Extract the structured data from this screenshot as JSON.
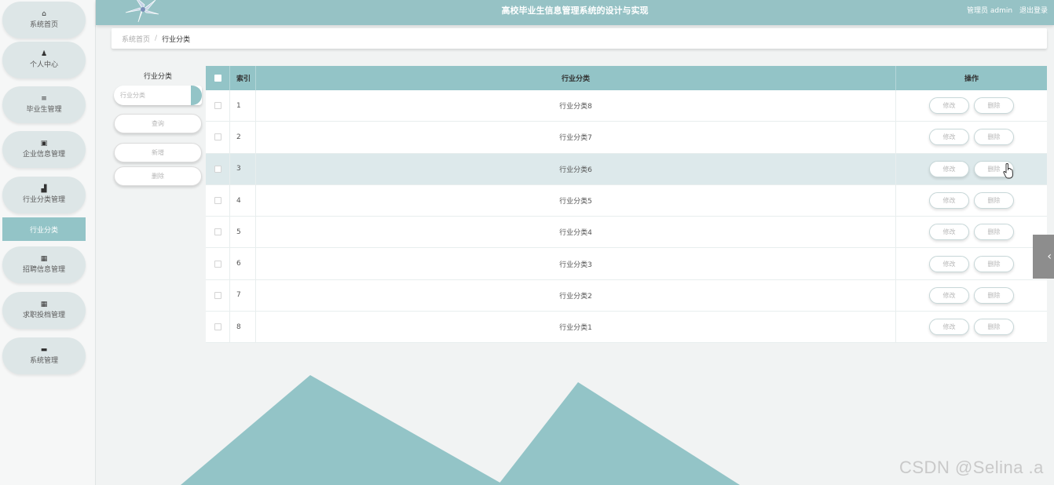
{
  "sidebar": {
    "items": [
      {
        "label": "系统首页",
        "icon": "home-icon",
        "glyph": "⌂"
      },
      {
        "label": "个人中心",
        "icon": "user-icon",
        "glyph": "♟"
      },
      {
        "label": "毕业生管理",
        "icon": "list-icon",
        "glyph": "≡"
      },
      {
        "label": "企业信息管理",
        "icon": "chart-icon",
        "glyph": "▣"
      },
      {
        "label": "行业分类管理",
        "icon": "thumb-icon",
        "glyph": "▟"
      },
      {
        "label": "招聘信息管理",
        "icon": "grid-icon",
        "glyph": "▦"
      },
      {
        "label": "求职投档管理",
        "icon": "grid-icon",
        "glyph": "▦"
      },
      {
        "label": "系统管理",
        "icon": "monitor-icon",
        "glyph": "▬"
      }
    ],
    "active_sub": "行业分类"
  },
  "header": {
    "title": "高校毕业生信息管理系统的设计与实现",
    "user": "管理员 admin",
    "logout": "退出登录"
  },
  "breadcrumb": {
    "home": "系统首页",
    "separator": "/",
    "current": "行业分类"
  },
  "search": {
    "title": "行业分类",
    "placeholder": "行业分类",
    "query_label": "查询",
    "add_label": "新增",
    "delete_label": "删除"
  },
  "table": {
    "headers": {
      "index": "索引",
      "name": "行业分类",
      "ops": "操作"
    },
    "edit_label": "修改",
    "delete_label": "删除",
    "rows": [
      {
        "index": "1",
        "name": "行业分类8"
      },
      {
        "index": "2",
        "name": "行业分类7"
      },
      {
        "index": "3",
        "name": "行业分类6"
      },
      {
        "index": "4",
        "name": "行业分类5"
      },
      {
        "index": "5",
        "name": "行业分类4"
      },
      {
        "index": "6",
        "name": "行业分类3"
      },
      {
        "index": "7",
        "name": "行业分类2"
      },
      {
        "index": "8",
        "name": "行业分类1"
      }
    ],
    "highlighted_row": 2
  },
  "watermark": "CSDN @Selina .a",
  "colors": {
    "accent": "#93c4c7",
    "row_highlight": "#dde9eb"
  }
}
